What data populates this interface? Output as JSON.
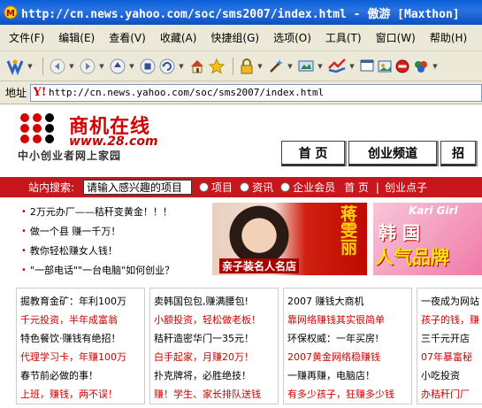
{
  "window": {
    "title": "http://cn.news.yahoo.com/soc/sms2007/index.html - 傲游 [Maxthon]"
  },
  "menu": [
    "文件(F)",
    "编辑(E)",
    "查看(V)",
    "收藏(A)",
    "快捷组(G)",
    "选项(O)",
    "工具(T)",
    "窗口(W)",
    "帮助(H)"
  ],
  "toolbar_icons": [
    "maxthon-icon",
    "back-icon",
    "forward-icon",
    "up-icon",
    "stop-icon",
    "refresh-icon",
    "home-icon",
    "favorites-star-icon",
    "lock-icon",
    "magic-icon",
    "screen-icon",
    "mail-icon",
    "close-icon",
    "puzzle-icon"
  ],
  "address": {
    "label": "地址",
    "url": "http://cn.news.yahoo.com/soc/sms2007/index.html",
    "favicon": "Y!"
  },
  "site": {
    "logo_title": "商机在线",
    "logo_url": "www.28.com",
    "slogan": "中小创业者网上家园",
    "brand_color": "#c8161d"
  },
  "nav_tabs": [
    "首  页",
    "创业频道",
    "招"
  ],
  "search": {
    "label": "站内搜索:",
    "placeholder": "请输入感兴趣的项目",
    "options": [
      "项目",
      "资讯",
      "企业会员"
    ],
    "links": [
      "首 页",
      "创业点子"
    ],
    "divider": "|"
  },
  "news": [
    "2万元办厂——秸秆变黄金！！！",
    "做一个县 赚一千万！",
    "教你轻松赚女人钱！",
    "\"一部电话\"\"一台电脑\"如何创业？"
  ],
  "ads": {
    "ad1": {
      "caption": "亲子装名人名店",
      "big": "蒋雯丽"
    },
    "ad2": {
      "brand": "Kari Girl",
      "line1": "韩 国",
      "line2": "人气品牌"
    }
  },
  "columns": [
    [
      {
        "text": "掘教育金矿：年利100万",
        "red": false
      },
      {
        "text": "千元投资，半年成富翁",
        "red": true
      },
      {
        "text": "特色餐饮·赚钱有绝招！",
        "red": false
      },
      {
        "text": "代理学习卡，年赚100万",
        "red": true
      },
      {
        "text": "春节前必做的事！",
        "red": false
      },
      {
        "text": "上班，赚钱，两不误！",
        "red": true
      }
    ],
    [
      {
        "text": "卖韩国包包,赚满腰包!",
        "red": false
      },
      {
        "text": "小额投资，轻松做老板！",
        "red": true
      },
      {
        "text": "秸秆造密华门一35元！",
        "red": false
      },
      {
        "text": "白手起家，月赚20万！",
        "red": true
      },
      {
        "text": "扑克牌将，必胜绝技！",
        "red": false
      },
      {
        "text": "赚！学生、家长排队送钱",
        "red": true
      }
    ],
    [
      {
        "text": "2007 赚钱大商机",
        "red": false
      },
      {
        "text": "靠网络赚钱其实很简单",
        "red": true
      },
      {
        "text": "环保权威：一年买房!",
        "red": false
      },
      {
        "text": "2007黄金网络稳赚钱",
        "red": true
      },
      {
        "text": "一赚再赚，电脑店！",
        "red": false
      },
      {
        "text": "有多少孩子，狂赚多少钱",
        "red": true
      }
    ],
    [
      {
        "text": "一夜成为网站",
        "red": false
      },
      {
        "text": "孩子的钱，赚",
        "red": true
      },
      {
        "text": "三千元开店",
        "red": false
      },
      {
        "text": "07年暴富秘",
        "red": true
      },
      {
        "text": "小吃投资",
        "red": false
      },
      {
        "text": "办秸秆门厂",
        "red": true
      }
    ]
  ]
}
